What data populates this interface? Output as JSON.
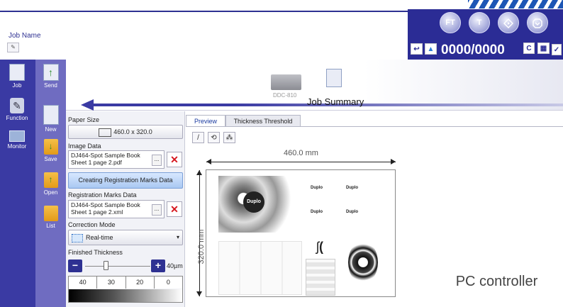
{
  "header": {
    "job_name_label": "Job Name",
    "counter": "0000/0000",
    "counter_c": "C",
    "circle_buttons": [
      "FT",
      "T",
      "",
      ""
    ]
  },
  "nav": {
    "primary": [
      {
        "label": "Job",
        "icon": "document-icon"
      },
      {
        "label": "Function",
        "icon": "wrench-icon"
      },
      {
        "label": "Monitor",
        "icon": "monitor-icon"
      }
    ],
    "secondary": [
      {
        "label": "Send",
        "icon": "send-icon"
      },
      {
        "label": "New",
        "icon": "new-document-icon"
      },
      {
        "label": "Save",
        "icon": "save-folder-icon"
      },
      {
        "label": "Open",
        "icon": "open-folder-icon"
      },
      {
        "label": "List",
        "icon": "list-folder-icon"
      }
    ]
  },
  "steps": {
    "machine_label": "DDC-810",
    "summary_label": "Job Summary"
  },
  "panel": {
    "paper_size_label": "Paper Size",
    "paper_size_value": "460.0 x 320.0",
    "image_data_label": "Image Data",
    "image_file_line1": "DJ464-Spot Sample Book",
    "image_file_line2": "Sheet 1 page 2.pdf",
    "browse_label": "...",
    "create_marks_label": "Creating Registration Marks Data",
    "reg_marks_label": "Registration Marks Data",
    "reg_file_line1": "DJ464-Spot Sample Book",
    "reg_file_line2": "Sheet 1 page 2.xml",
    "correction_mode_label": "Correction Mode",
    "correction_mode_value": "Real-time",
    "finished_thickness_label": "Finished Thickness",
    "thickness_value": "40µm",
    "minus_label": "−",
    "plus_label": "+",
    "scale_values": [
      "40",
      "30",
      "20",
      "0"
    ]
  },
  "preview": {
    "tabs": [
      "Preview",
      "Thickness Threshold"
    ],
    "width_label": "460.0 mm",
    "height_label": "320.0 mm",
    "brand_text": "Duplo"
  },
  "caption": "PC controller",
  "colors": {
    "nav_dark": "#3a3aa3",
    "nav_light": "#6f6cc1",
    "control_panel": "#2b2c95",
    "accent_red": "#d6161e"
  }
}
